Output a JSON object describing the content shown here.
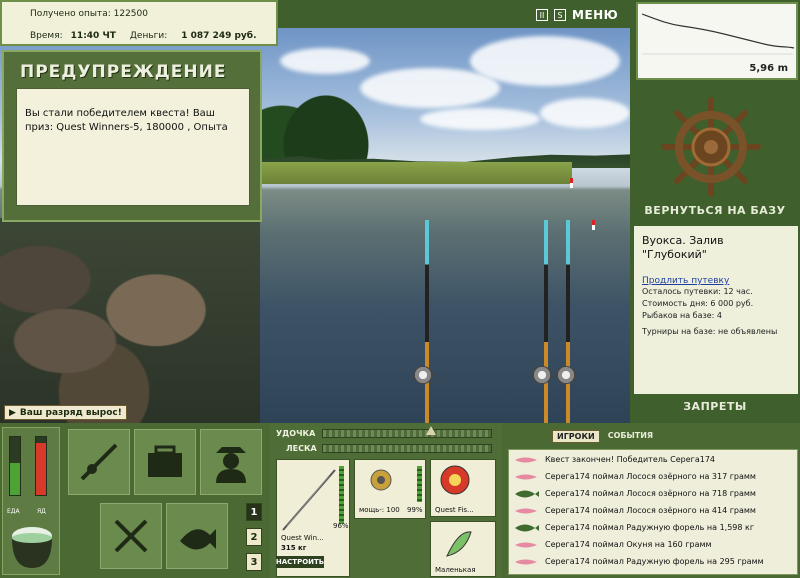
{
  "top_info": {
    "experience_label": "Получено опыта:",
    "experience_value": "122500",
    "time_label": "Время:",
    "time_value": "11:40 ЧТ",
    "money_label": "Деньги:",
    "money_value": "1 087 249 руб."
  },
  "warning": {
    "title": "ПРЕДУПРЕЖДЕНИЕ",
    "message": "Вы стали победителем квеста! Ваш приз: Quest Winners-5, 180000 , Опыта"
  },
  "top_icons": {
    "pause": "II",
    "sound": "S",
    "menu_label": "МЕНЮ"
  },
  "depth": {
    "value": "5,96 m"
  },
  "base": {
    "return_label": "ВЕРНУТЬСЯ НА БАЗУ",
    "name_line1": "Вуокса. Залив",
    "name_line2": "\"Глубокий\"",
    "extend_link": "Продлить путевку",
    "remaining": "Осталось путевки: 12 час.",
    "cost": "Стоимость дня: 6 000 руб.",
    "anglers": "Рыбаков на базе: 4",
    "tournaments": "Турниры на базе: не объявлены"
  },
  "bans_label": "ЗАПРЕТЫ",
  "rank_notice": "Ваш разряд вырос!",
  "vitals": {
    "food_label": "ЕДА",
    "poison_label": "ЯД",
    "food_level": 0.55,
    "poison_level": 0.9
  },
  "num_buttons": [
    "1",
    "2",
    "3"
  ],
  "tackle": {
    "rod_label": "УДОЧКА",
    "line_label": "ЛЕСКА",
    "rod_name": "Quest Win...",
    "rod_weight": "315 кг",
    "rod_percent": "96%",
    "reel_name": "мощь-: 100",
    "reel_percent": "99%",
    "bait_name": "Quest Fis...",
    "lure_name": "Маленькая",
    "setup_button": "НАСТРОИТЬ"
  },
  "chat": {
    "tabs": [
      "ИГРОКИ",
      "СОБЫТИЯ"
    ],
    "messages": [
      "Квест закончен! Победитель Серега174",
      "Серега174 поймал Лосося озёрного на 317 грамм",
      "Серега174 поймал Лосося озёрного на 718 грамм",
      "Серега174 поймал Лосося озёрного на 414 грамм",
      "Серега174 поймал Радужную форель на 1,598 кг",
      "Серега174 поймал Окуня на 160 грамм",
      "Серега174 поймал Радужную форель на 295 грамм"
    ]
  },
  "colors": {
    "panel_green": "#4b6a33",
    "paper": "#f1f0d8",
    "accent_red": "#d83a2a",
    "bar_green": "#4da236"
  }
}
